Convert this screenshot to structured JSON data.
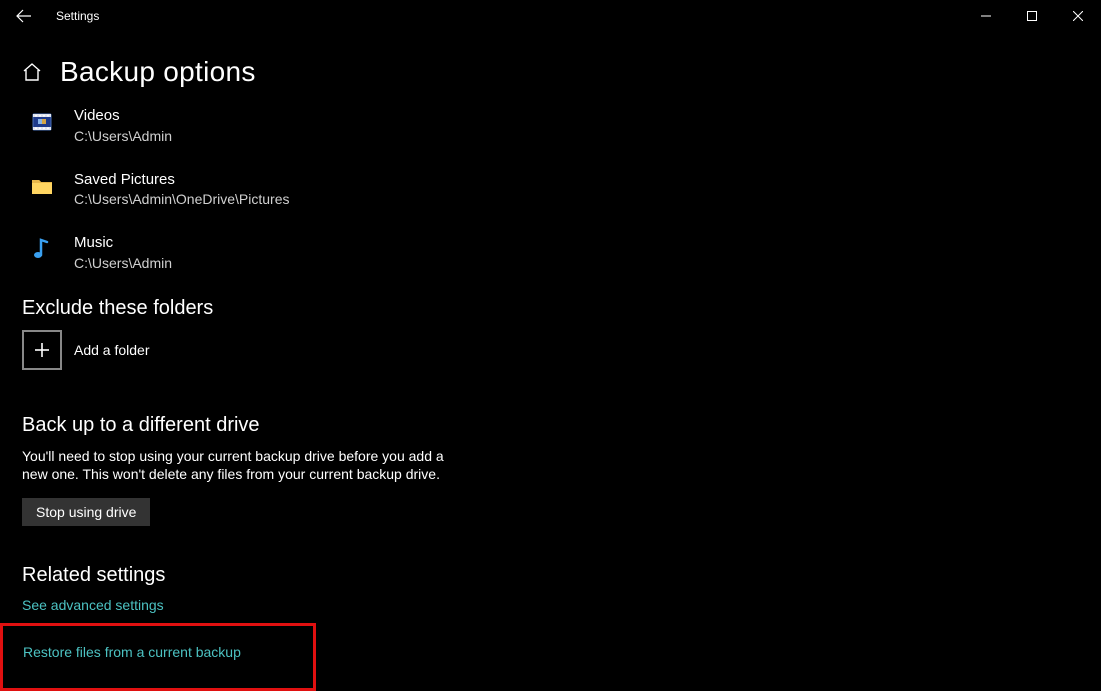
{
  "titlebar": {
    "app_title": "Settings"
  },
  "header": {
    "page_title": "Backup options"
  },
  "folders": [
    {
      "name": "Videos",
      "path": "C:\\Users\\Admin",
      "icon": "video"
    },
    {
      "name": "Saved Pictures",
      "path": "C:\\Users\\Admin\\OneDrive\\Pictures",
      "icon": "folder"
    },
    {
      "name": "Music",
      "path": "C:\\Users\\Admin",
      "icon": "music"
    }
  ],
  "exclude": {
    "title": "Exclude these folders",
    "add_label": "Add a folder"
  },
  "different_drive": {
    "title": "Back up to a different drive",
    "description": "You'll need to stop using your current backup drive before you add a new one. This won't delete any files from your current backup drive.",
    "button": "Stop using drive"
  },
  "related": {
    "title": "Related settings",
    "link1": "See advanced settings",
    "link2": "Restore files from a current backup"
  }
}
